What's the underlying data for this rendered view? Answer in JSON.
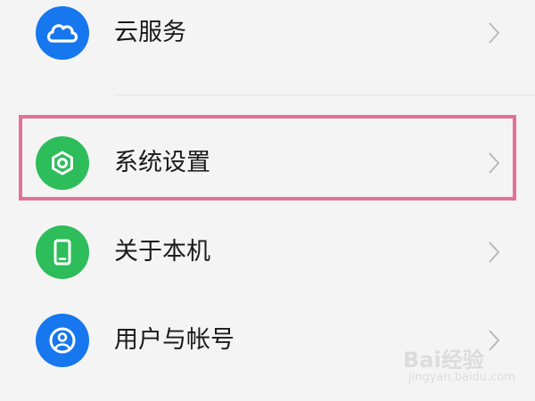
{
  "settings": {
    "items": [
      {
        "label": "云服务",
        "icon": "cloud-icon",
        "color": "#1677ee"
      },
      {
        "label": "系统设置",
        "icon": "hexagon-gear-icon",
        "color": "#2dbd5a"
      },
      {
        "label": "关于本机",
        "icon": "phone-icon",
        "color": "#2dbd5a"
      },
      {
        "label": "用户与帐号",
        "icon": "user-account-icon",
        "color": "#1677ee"
      }
    ]
  },
  "highlight": {
    "target": "系统设置",
    "color": "#e3719a"
  },
  "watermark": {
    "brand": "Bai经验",
    "url": "jingyan.baidu.com"
  }
}
